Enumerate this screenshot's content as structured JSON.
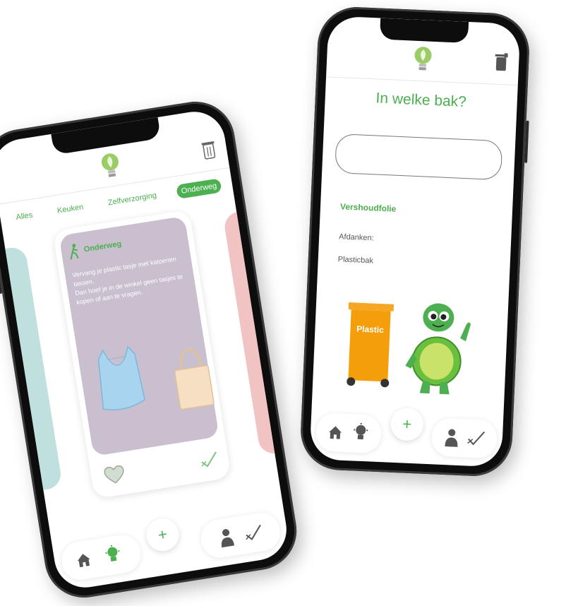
{
  "screenA": {
    "tabs": [
      {
        "label": "Alles",
        "active": false
      },
      {
        "label": "Keuken",
        "active": false
      },
      {
        "label": "Zelfverzorging",
        "active": false
      },
      {
        "label": "Onderweg",
        "active": true
      }
    ],
    "card": {
      "category": "Onderweg",
      "tip": "Vervang je plastic tasje met katoenen tassen.\nDan hoef je in de winkel geen tasjes te kopen of aan te vragen."
    },
    "nav": {
      "plus_label": "+"
    }
  },
  "screenB": {
    "title": "In welke bak?",
    "search_value": "",
    "item_name": "Vershoudfolie",
    "dispose_label": "Afdanken:",
    "dispose_value": "Plasticbak",
    "bin_label": "Plastic",
    "nav": {
      "plus_label": "+"
    }
  },
  "colors": {
    "accent": "#4caf50",
    "card_bg": "#c9bfcf",
    "bin": "#f59e0b",
    "ghost_left": "#bfe0dc",
    "ghost_right": "#f1c3c3"
  },
  "icons": [
    "bulb-icon",
    "trash-icon",
    "walking-icon",
    "heart-icon",
    "check-icon",
    "home-icon",
    "user-icon"
  ]
}
